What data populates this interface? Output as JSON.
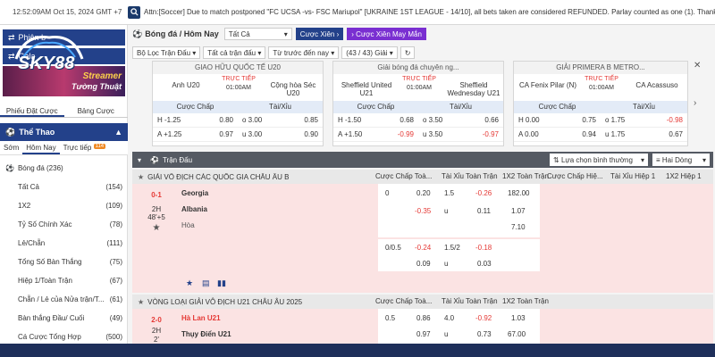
{
  "topbar": {
    "datetime": "12:52:09AM Oct 15, 2024 GMT +7",
    "ticker": "Attn:[Soccer] Due to match postponed \"FC UCSA -vs- FSC Mariupol\" [UKRAINE 1ST LEAGUE - 14/10], all bets taken are considered REFUNDED. Parlay counted as one (1). Thank"
  },
  "sidebar": {
    "btn1": "Phiên b",
    "btn2": "Gala",
    "logo_text": "SKY88",
    "banner_text1": "Streamer",
    "banner_text2": "Tường Thuật",
    "subtabs": [
      "Phiếu Đặt Cược",
      "Bảng Cược"
    ],
    "sport": "Thể Thao",
    "timetabs": [
      "Sớm",
      "Hôm Nay",
      "Trực tiếp"
    ],
    "live_count": "114",
    "menu_first": "Bóng đá",
    "menu_first_count": "(236)",
    "menu": [
      {
        "label": "Tất Cả",
        "count": "(154)"
      },
      {
        "label": "1X2",
        "count": "(109)"
      },
      {
        "label": "Tỷ Số Chính Xác",
        "count": "(78)"
      },
      {
        "label": "Lẻ/Chẵn",
        "count": "(111)"
      },
      {
        "label": "Tổng Số Bàn Thắng",
        "count": "(75)"
      },
      {
        "label": "Hiệp 1/Toàn Trận",
        "count": "(67)"
      },
      {
        "label": "Chẵn / Lẻ của Nửa trận/T...",
        "count": "(61)"
      },
      {
        "label": "Bàn thắng Đầu/ Cuối",
        "count": "(49)"
      },
      {
        "label": "Cá Cược Tổng Hợp",
        "count": "(500)"
      }
    ]
  },
  "filters": {
    "sport": "Bóng đá / Hôm Nay",
    "all": "Tất Cả",
    "parlay": "Cược Xiên",
    "parlay_lucky": "Cược Xiên May Mắn",
    "league_filter": "Bộ Lọc Trận Đấu",
    "odds_type": "Tất cả trận đấu",
    "sort": "Từ trước đến nay",
    "range": "(43 / 43) Giải"
  },
  "cards": [
    {
      "title": "GIAO HỮU QUỐC TẾ U20",
      "home": "Anh U20",
      "away": "Cộng hòa Séc U20",
      "live": "TRỰC TIẾP",
      "time": "01:00AM",
      "h_hcp": "H -1.25",
      "h_odds": "0.80",
      "h_ou": "o 3.00",
      "h_ou_odds": "0.85",
      "a_hcp": "A +1.25",
      "a_odds": "0.97",
      "a_ou": "u 3.00",
      "a_ou_odds": "0.90"
    },
    {
      "title": "Giải bóng đá chuyên ng...",
      "home": "Sheffield United U21",
      "away": "Sheffield Wednesday U21",
      "live": "TRỰC TIẾP",
      "time": "01:00AM",
      "h_hcp": "H -1.50",
      "h_odds": "0.68",
      "h_ou": "o 3.50",
      "h_ou_odds": "0.66",
      "a_hcp": "A +1.50",
      "a_odds": "-0.99",
      "a_ou": "u 3.50",
      "a_ou_odds": "-0.97"
    },
    {
      "title": "GIẢI PRIMERA B METRO...",
      "home": "CA Fenix Pilar (N)",
      "away": "CA Acassuso",
      "live": "TRỰC TIẾP",
      "time": "01:00AM",
      "h_hcp": "H 0.00",
      "h_odds": "0.75",
      "h_ou": "o 1.75",
      "h_ou_odds": "-0.98",
      "a_hcp": "A 0.00",
      "a_odds": "0.94",
      "a_ou": "u 1.75",
      "a_ou_odds": "0.67"
    }
  ],
  "card_headers": {
    "hcp": "Cược Chấp",
    "ou": "Tài/Xỉu"
  },
  "table": {
    "title": "Trận Đấu",
    "sort": "Lựa chọn bình thường",
    "lines": "Hai Dòng",
    "cols": [
      "Cược Chấp Toà...",
      "Tài Xỉu Toàn Trận",
      "1X2 Toàn Trận",
      "Cược Chấp Hiệ...",
      "Tài Xỉu Hiệp 1",
      "1X2 Hiệp 1"
    ],
    "league1": "GIẢI VÔ ĐỊCH CÁC QUỐC GIA CHÂU ÂU B",
    "m1": {
      "score": "0-1",
      "half": "2H",
      "min": "48'+5",
      "home": "Georgia",
      "away": "Albania",
      "draw": "Hòa",
      "r1": [
        "0",
        "0.20",
        "1.5",
        "-0.26",
        "182.00"
      ],
      "r2": [
        "-0.35",
        "u",
        "0.11",
        "1.07"
      ],
      "r3": "7.10",
      "r4": [
        "0/0.5",
        "-0.24",
        "1.5/2",
        "-0.18"
      ],
      "r5": [
        "0.09",
        "u",
        "0.03"
      ]
    },
    "league2": "VÒNG LOẠI GIẢI VÔ ĐỊCH U21 CHÂU ÂU 2025",
    "m2": {
      "score": "2-0",
      "half": "2H",
      "min": "2'",
      "home": "Hà Lan U21",
      "away": "Thụy Điển U21",
      "r1": [
        "0.5",
        "0.86",
        "4.0",
        "-0.92",
        "1.03"
      ],
      "r2": [
        "0.97",
        "u",
        "0.73",
        "67.00"
      ]
    }
  }
}
